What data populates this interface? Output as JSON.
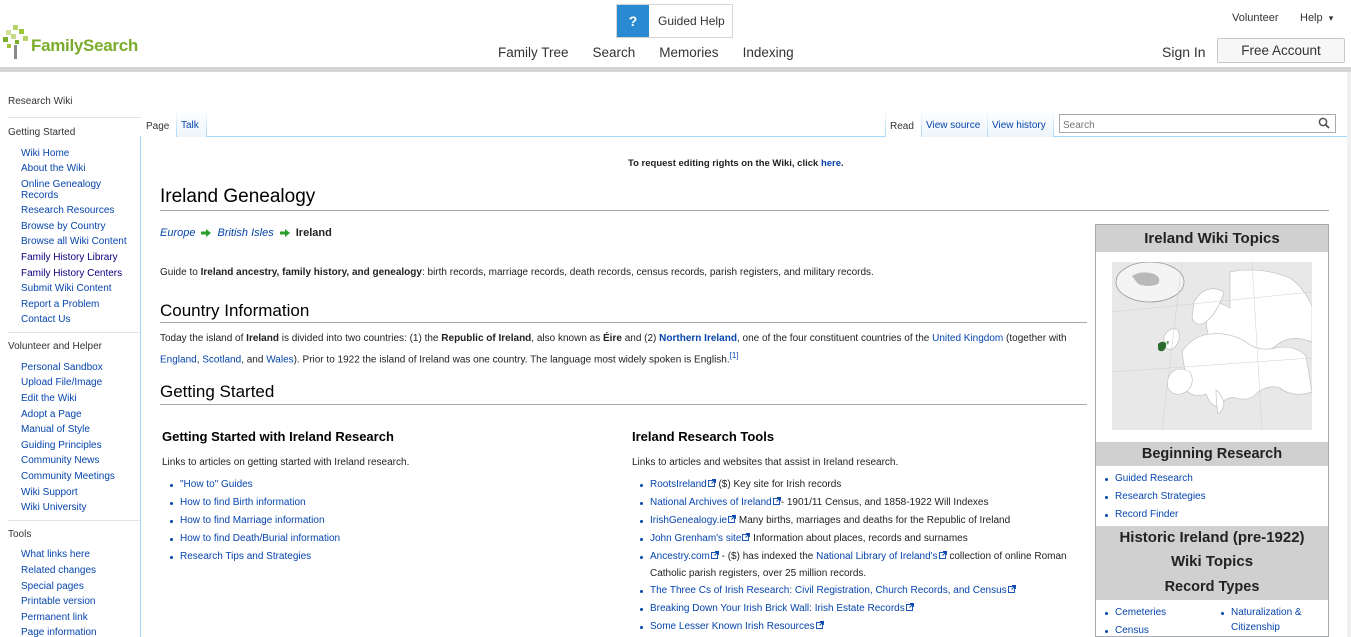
{
  "header": {
    "logo_text": "FamilySearch",
    "guided_help": "Guided Help",
    "guided_help_icon": "?",
    "nav": [
      "Family Tree",
      "Search",
      "Memories",
      "Indexing"
    ],
    "volunteer": "Volunteer",
    "help": "Help",
    "help_caret": "▾",
    "sign_in": "Sign In",
    "free_account": "Free Account"
  },
  "sidebar": {
    "top_link": "Research Wiki",
    "sections": [
      {
        "title": "Getting Started",
        "items": [
          "Wiki Home",
          "About the Wiki",
          "Online Genealogy Records",
          "Research Resources",
          "Browse by Country",
          "Browse all Wiki Content",
          "Family History Library",
          "Family History Centers",
          "Submit Wiki Content",
          "Report a Problem",
          "Contact Us"
        ]
      },
      {
        "title": "Volunteer and Helper",
        "items": [
          "Personal Sandbox",
          "Upload File/Image",
          "Edit the Wiki",
          "Adopt a Page",
          "Manual of Style",
          "Guiding Principles",
          "Community News",
          "Community Meetings",
          "Wiki Support",
          "Wiki University"
        ]
      },
      {
        "title": "Tools",
        "items": [
          "What links here",
          "Related changes",
          "Special pages",
          "Printable version",
          "Permanent link",
          "Page information"
        ]
      }
    ]
  },
  "tabs": {
    "page": "Page",
    "talk": "Talk",
    "read": "Read",
    "view_source": "View source",
    "view_history": "View history",
    "search_placeholder": "Search"
  },
  "notice": {
    "text": "To request editing rights on the Wiki, click ",
    "link": "here",
    "end": "."
  },
  "article": {
    "title": "Ireland Genealogy",
    "breadcrumbs": [
      "Europe",
      "British Isles",
      "Ireland"
    ],
    "intro_pre": "Guide to ",
    "intro_bold": "Ireland ancestry, family history, and genealogy",
    "intro_post": ": birth records, marriage records, death records, census records, parish registers, and military records.",
    "country_heading": "Country Information",
    "country_para": {
      "p1": "Today the island of ",
      "b1": "Ireland",
      "p2": " is divided into two countries: (1) the ",
      "b2": "Republic of Ireland",
      "p3": ", also known as ",
      "b3": "Éire",
      "p4": " and (2) ",
      "l1": "Northern Ireland",
      "p5": ", one of the four constituent countries of the ",
      "l2": "United Kingdom",
      "p6": " (together with ",
      "l3": "England",
      "p7": ", ",
      "l4": "Scotland",
      "p8": ", and ",
      "l5": "Wales",
      "p9": "). Prior to 1922 the island of Ireland was one country. The language most widely spoken is English.",
      "ref": "[1]"
    },
    "getting_started_heading": "Getting Started",
    "gs_col": {
      "title": "Getting Started with Ireland Research",
      "desc": "Links to articles on getting started with Ireland research.",
      "items": [
        "\"How to\" Guides",
        "How to find Birth information",
        "How to find Marriage information",
        "How to find Death/Burial information",
        "Research Tips and Strategies"
      ]
    },
    "tools_col": {
      "title": "Ireland Research Tools",
      "desc": "Links to articles and websites that assist in Ireland research.",
      "items": [
        {
          "link": "RootsIreland",
          "rest": " ($) Key site for Irish records"
        },
        {
          "link": "National Archives of Ireland",
          "rest": "- 1901/11 Census, and 1858-1922 Will Indexes"
        },
        {
          "link": "IrishGenealogy.ie",
          "rest": " Many births, marriages and deaths for the Republic of Ireland"
        },
        {
          "link": "John Grenham's site",
          "rest": " Information about places, records and surnames"
        },
        {
          "link": "Ancestry.com",
          "rest": " - ($) has indexed the ",
          "link2": "National Library of Ireland's",
          "rest2": " collection of online Roman Catholic parish registers, over 25 million records."
        },
        {
          "link": "The Three Cs of Irish Research: Civil Registration, Church Records, and Census",
          "rest": ""
        },
        {
          "link": "Breaking Down Your Irish Brick Wall: Irish Estate Records",
          "rest": ""
        },
        {
          "link": "Some Lesser Known Irish Resources",
          "rest": ""
        }
      ]
    }
  },
  "infobox": {
    "title": "Ireland Wiki Topics",
    "beginning": "Beginning Research",
    "beginning_items": [
      "Guided Research",
      "Research Strategies",
      "Record Finder"
    ],
    "historic": "Historic Ireland (pre-1922)",
    "historic2": "Wiki Topics",
    "record_types": "Record Types",
    "record_items_left": [
      "Cemeteries",
      "Census"
    ],
    "record_items_right": [
      "Naturalization &",
      "Citizenship"
    ]
  },
  "colors": {
    "link": "#0645ad",
    "brand_green": "#7cac2b",
    "help_blue": "#2a8ad1",
    "infobox_header": "#d0d0d0"
  }
}
